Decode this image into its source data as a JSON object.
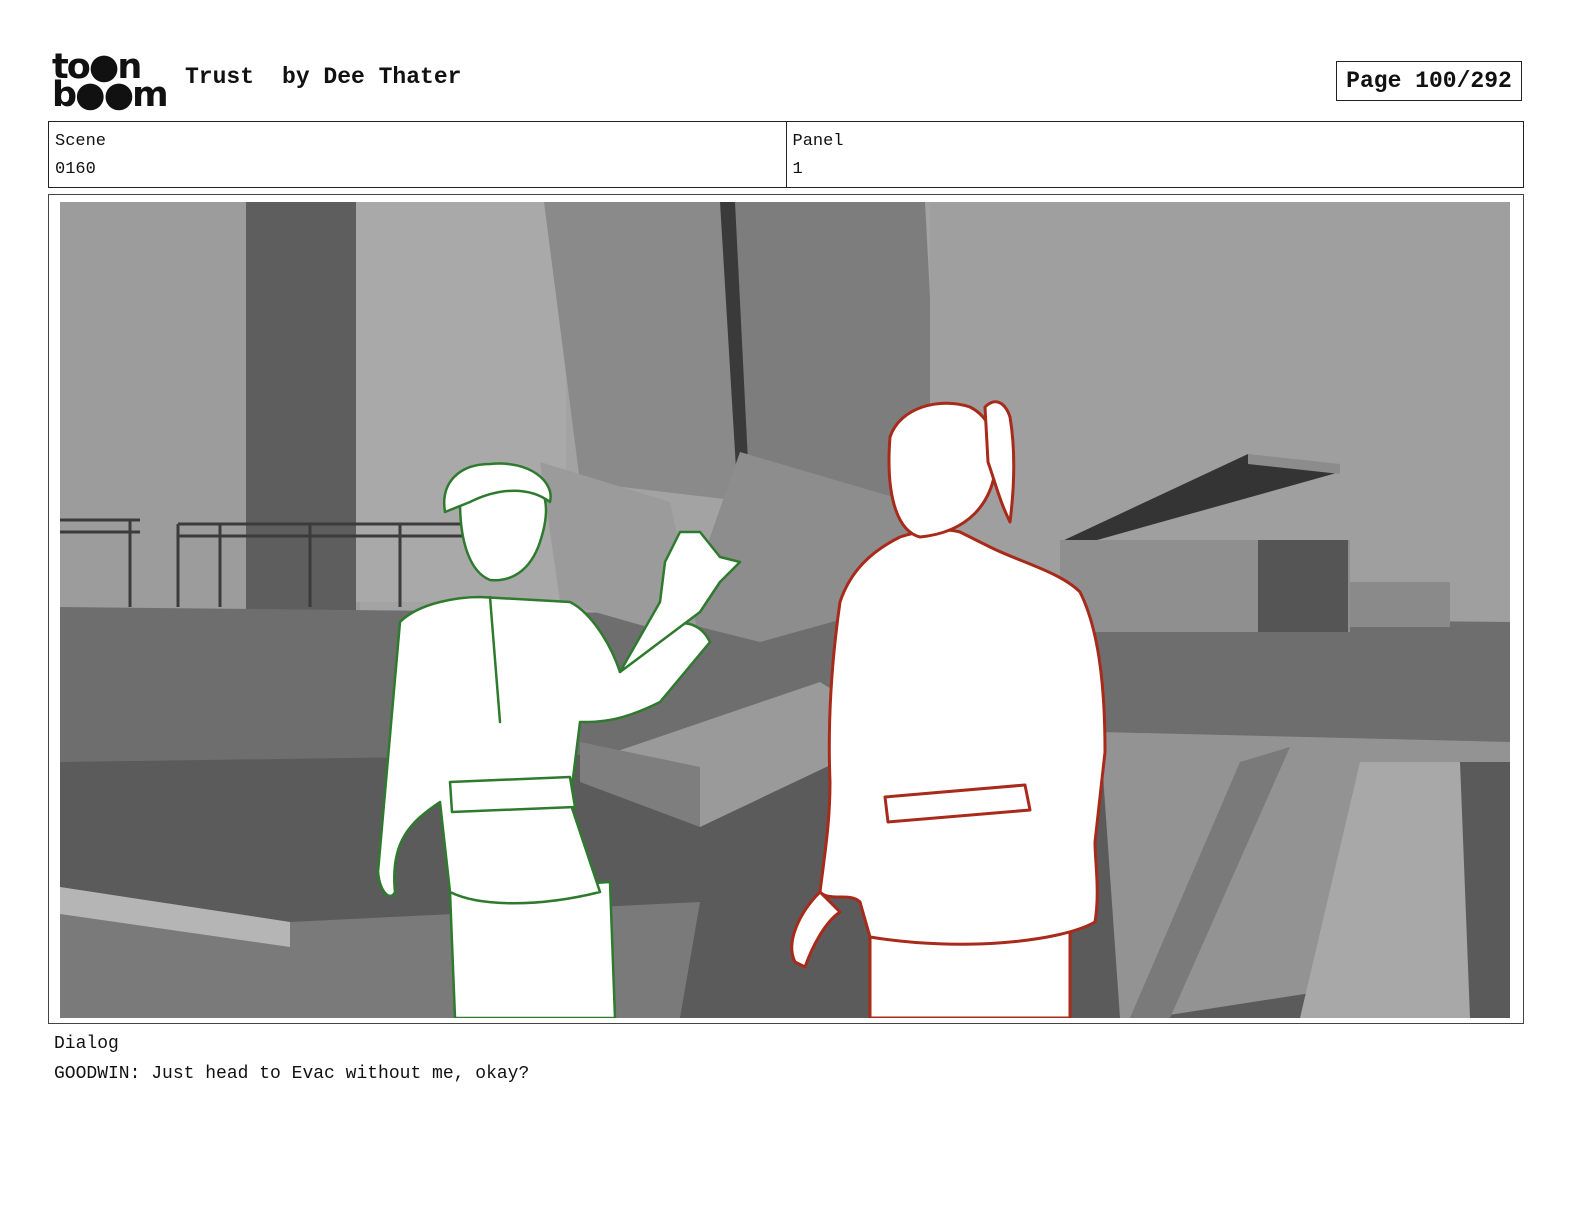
{
  "header": {
    "logo_line1": "to●n",
    "logo_line2": "b●●m",
    "logo_text": "toon boom",
    "title": "Trust",
    "author": "by Dee Thater",
    "page_label": "Page 100/292"
  },
  "info": {
    "scene_label": "Scene",
    "scene_value": "0160",
    "panel_label": "Panel",
    "panel_value": "1"
  },
  "panel": {
    "image_description_icon": "storyboard-sketch",
    "colors": {
      "left_character": "#2e7a2e",
      "right_character": "#a82a1a",
      "background_gray": "#9a9a9a"
    }
  },
  "dialog": {
    "label": "Dialog",
    "text": "GOODWIN: Just head to Evac without me, okay?"
  }
}
